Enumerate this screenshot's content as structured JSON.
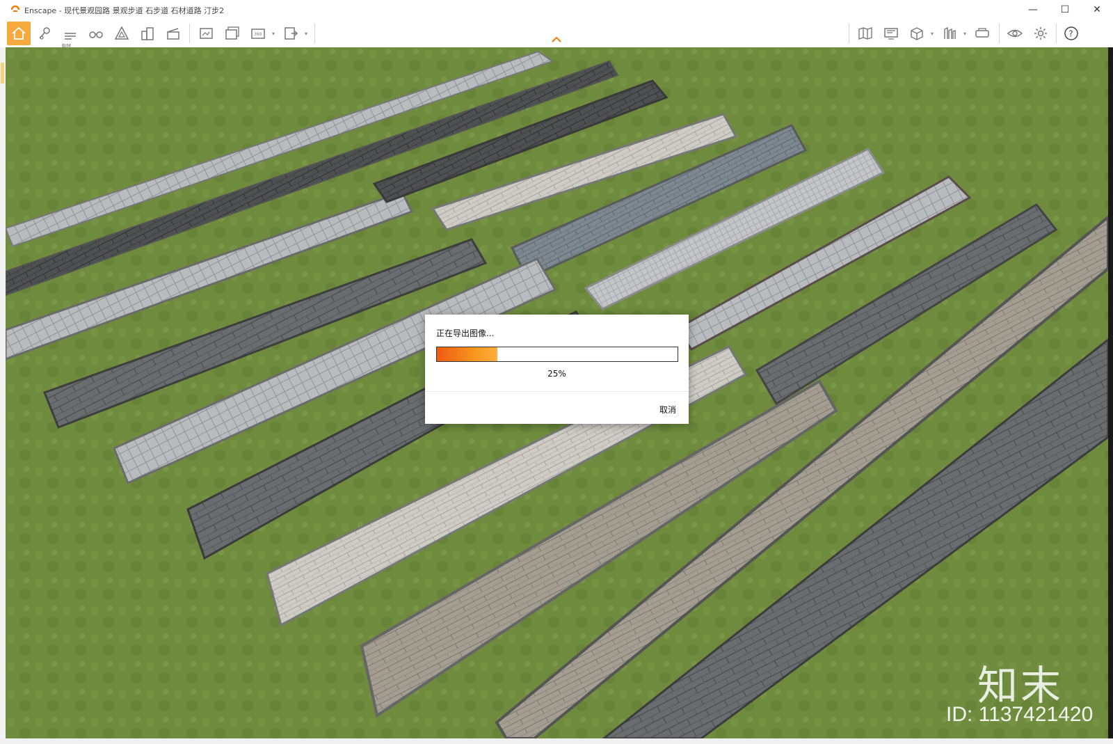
{
  "window": {
    "title": "Enscape - 现代景观园路 景观步道 石步道 石材道路 汀步2",
    "minimize_glyph": "—",
    "maximize_glyph": "☐",
    "close_glyph": "✕"
  },
  "toolbar": {
    "bim_label": "BIM",
    "left_tools": [
      "home-icon",
      "pin-icon",
      "bim-icon",
      "binoculars-icon",
      "architectural-icon",
      "buildings-icon",
      "clapper-icon",
      "screenshot-icon",
      "batch-render-icon",
      "panorama-360-icon",
      "export-exe-icon"
    ],
    "right_tools": [
      "map-icon",
      "monitor-icon",
      "box-view-icon",
      "library-icon",
      "vr-headset-icon",
      "eye-icon",
      "settings-gear-icon",
      "help-icon"
    ]
  },
  "dialog": {
    "title": "正在导出图像...",
    "progress_percent": 25,
    "progress_label": "25%",
    "cancel_label": "取消"
  },
  "watermark": {
    "logo_text": "知末",
    "id_text": "ID: 1137421420"
  },
  "colors": {
    "accent": "#f6a93c",
    "progress_start": "#f05a14",
    "progress_end": "#fbb03b",
    "grass": "#6b8a3c"
  }
}
